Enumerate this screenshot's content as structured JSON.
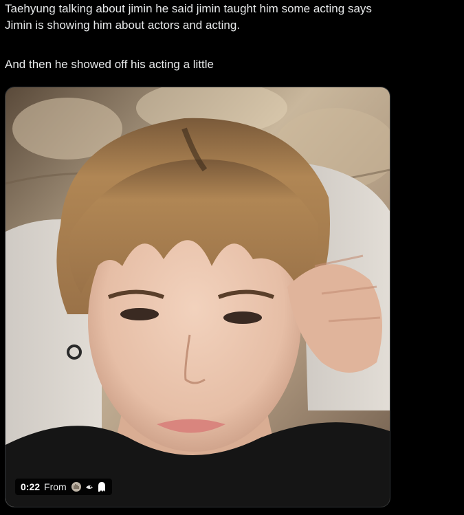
{
  "tweet": {
    "line1": "Taehyung talking about jimin he said jimin taught him some acting says",
    "line2": "Jimin is showing him about actors and acting.",
    "line3": "And then he showed off his acting a little"
  },
  "video": {
    "duration": "0:22",
    "from_label": "From",
    "source_icons": [
      "hand-emoji-icon",
      "bird-emoji-icon",
      "ghost-emoji-icon"
    ]
  },
  "colors": {
    "background": "#000000",
    "text": "#e7e9ea",
    "badge_bg": "#000000"
  }
}
